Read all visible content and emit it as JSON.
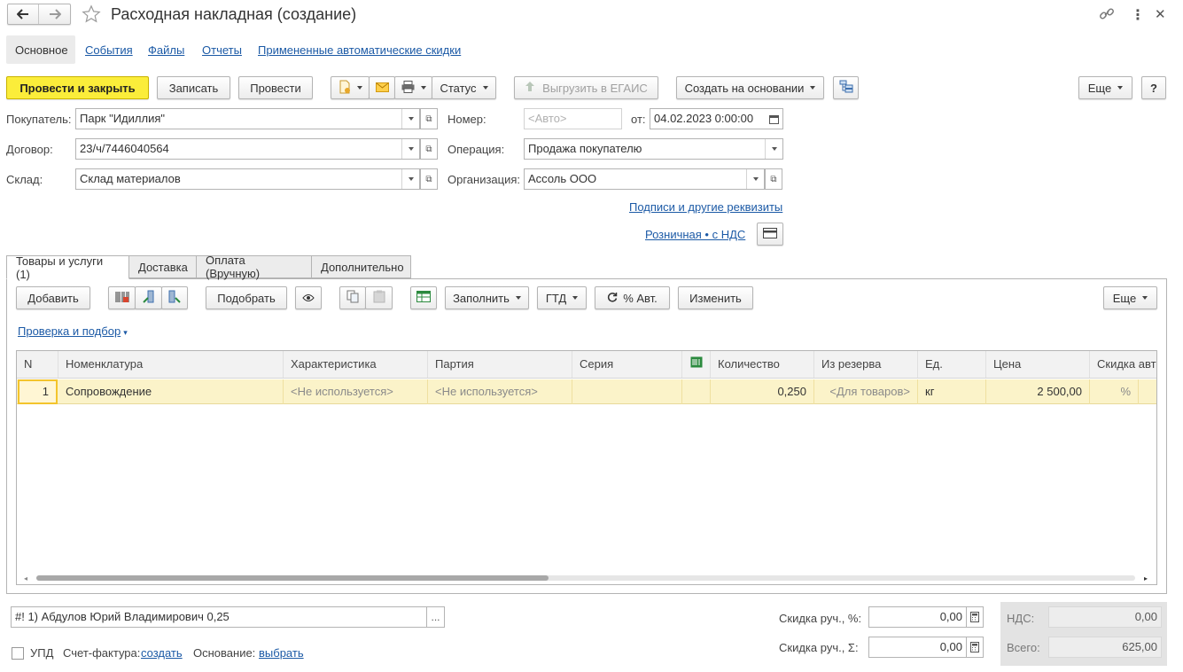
{
  "title": "Расходная накладная (создание)",
  "form_tabs": [
    "Основное",
    "События",
    "Файлы",
    "Отчеты",
    "Примененные автоматические скидки"
  ],
  "toolbar": {
    "post_close": "Провести и закрыть",
    "save": "Записать",
    "post": "Провести",
    "status": "Статус",
    "egais": "Выгрузить в ЕГАИС",
    "create_based": "Создать на основании",
    "more": "Еще",
    "help": "?"
  },
  "header": {
    "buyer_label": "Покупатель:",
    "buyer_value": "Парк \"Идиллия\"",
    "contract_label": "Договор:",
    "contract_value": "23/ч/7446040564",
    "warehouse_label": "Склад:",
    "warehouse_value": "Склад материалов",
    "number_label": "Номер:",
    "number_placeholder": "<Авто>",
    "date_label": "от:",
    "date_value": "04.02.2023  0:00:00",
    "operation_label": "Операция:",
    "operation_value": "Продажа покупателю",
    "org_label": "Организация:",
    "org_value": "Ассоль ООО",
    "signatures_link": "Подписи и другие реквизиты",
    "price_type_link": "Розничная • с НДС"
  },
  "doc_tabs": [
    "Товары и услуги (1)",
    "Доставка",
    "Оплата (Вручную)",
    "Дополнительно"
  ],
  "table_toolbar": {
    "add": "Добавить",
    "pick": "Подобрать",
    "fill": "Заполнить",
    "gtd": "ГТД",
    "auto_pct": "% Авт.",
    "change": "Изменить",
    "more": "Еще",
    "check_link": "Проверка и подбор"
  },
  "table": {
    "columns": [
      "N",
      "Номенклатура",
      "Характеристика",
      "Партия",
      "Серия",
      "",
      "Количество",
      "Из резерва",
      "Ед.",
      "Цена",
      "Скидка авт"
    ],
    "rows": [
      {
        "n": "1",
        "item": "Сопровождение",
        "characteristic": "<Не используется>",
        "batch": "<Не используется>",
        "series": "",
        "qty": "0,250",
        "reserve": "<Для товаров>",
        "unit": "кг",
        "price": "2 500,00",
        "discount": "%"
      }
    ]
  },
  "footer": {
    "comment": "#! 1) Абдулов Юрий Владимирович 0,25",
    "comment_btn": "...",
    "upd_label": "УПД",
    "invoice_label": "Счет-фактура:",
    "invoice_link": "создать",
    "basis_label": "Основание:",
    "basis_link": "выбрать",
    "disc_pct_label": "Скидка руч., %:",
    "disc_pct_value": "0,00",
    "disc_sum_label": "Скидка руч., Σ:",
    "disc_sum_value": "0,00",
    "vat_label": "НДС:",
    "vat_value": "0,00",
    "total_label": "Всего:",
    "total_value": "625,00"
  },
  "colors": {
    "accent_yellow": "#fbed3a",
    "link_blue": "#1c5aa6",
    "row_highlight": "#fbf3c9"
  }
}
